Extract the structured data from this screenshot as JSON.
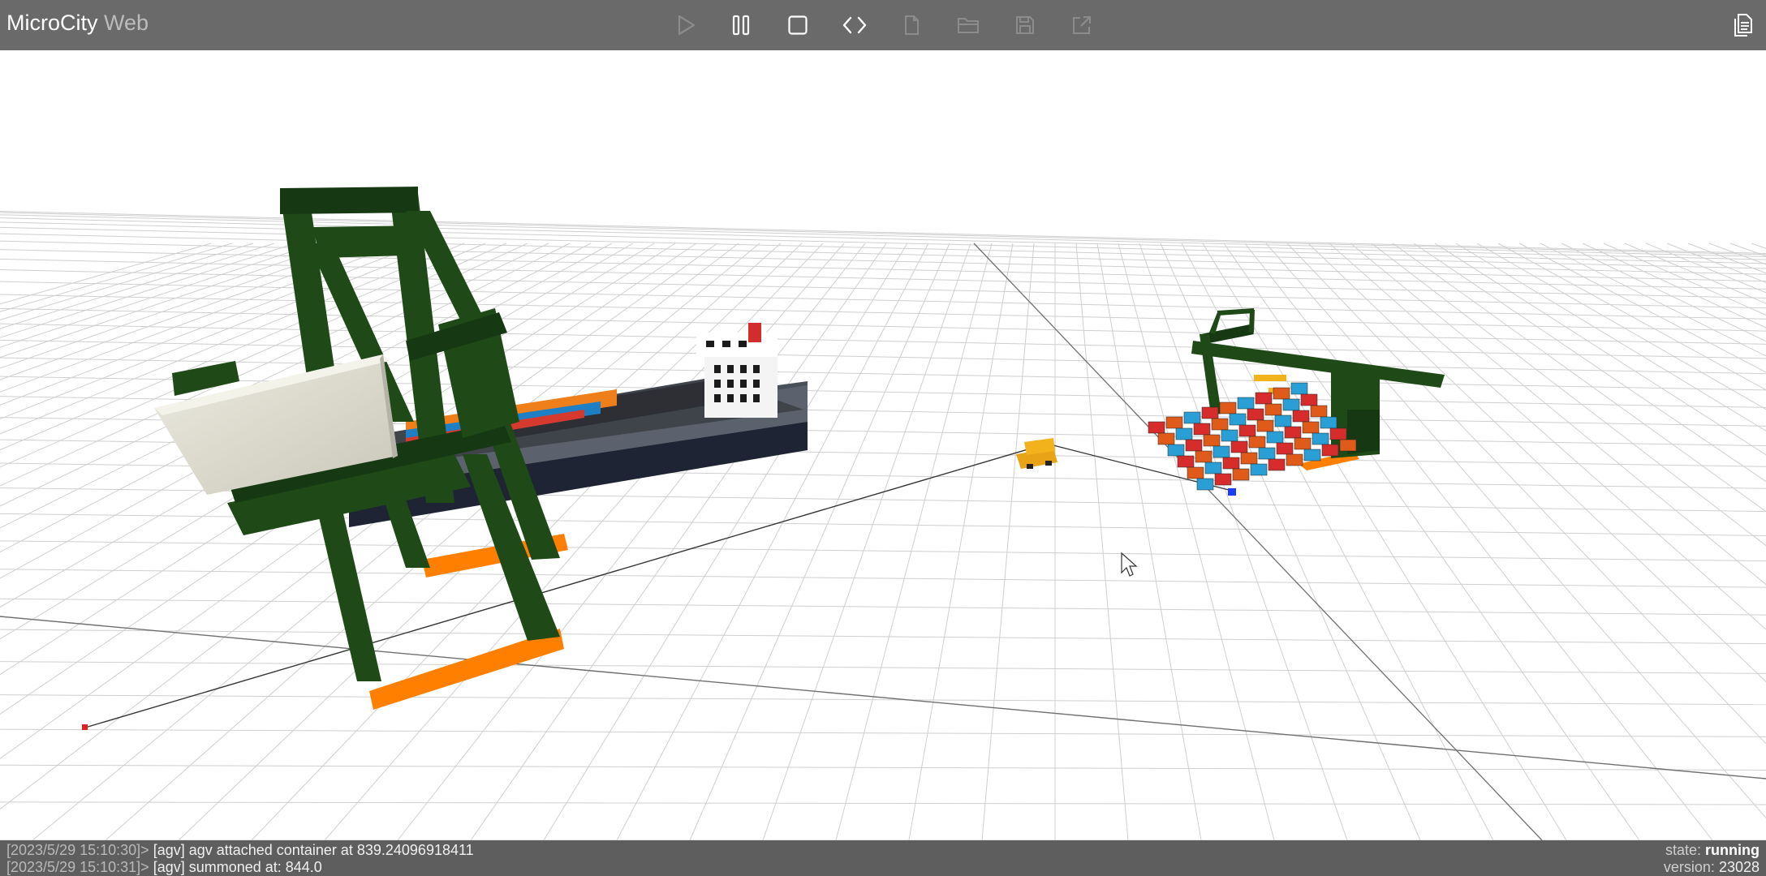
{
  "app": {
    "title_main": "MicroCity",
    "title_sub": "Web"
  },
  "toolbar": {
    "buttons": [
      {
        "name": "run-button",
        "icon": "play-icon",
        "enabled": false
      },
      {
        "name": "pause-button",
        "icon": "pause-icon",
        "enabled": true
      },
      {
        "name": "stop-button",
        "icon": "stop-icon",
        "enabled": true
      },
      {
        "name": "code-button",
        "icon": "code-icon",
        "enabled": true
      },
      {
        "name": "new-file-button",
        "icon": "file-icon",
        "enabled": false
      },
      {
        "name": "open-folder-button",
        "icon": "folder-icon",
        "enabled": false
      },
      {
        "name": "save-button",
        "icon": "save-icon",
        "enabled": false
      },
      {
        "name": "export-button",
        "icon": "external-link-icon",
        "enabled": false
      }
    ],
    "docs_icon": "documents-icon"
  },
  "console": {
    "lines": [
      {
        "timestamp": "[2023/5/29 15:10:30]>",
        "message": "[agv] agv attached container at 839.24096918411"
      },
      {
        "timestamp": "[2023/5/29 15:10:31]>",
        "message": "[agv] summoned at: 844.0"
      }
    ],
    "state_label": "state:",
    "state_value": "running",
    "version_label": "version:",
    "version_value": "23028"
  },
  "scene": {
    "crane_color": "#1f4a17",
    "base_color": "#ff8c00",
    "ship_hull_color": "#555b63",
    "agv_color": "#f2b21c"
  }
}
